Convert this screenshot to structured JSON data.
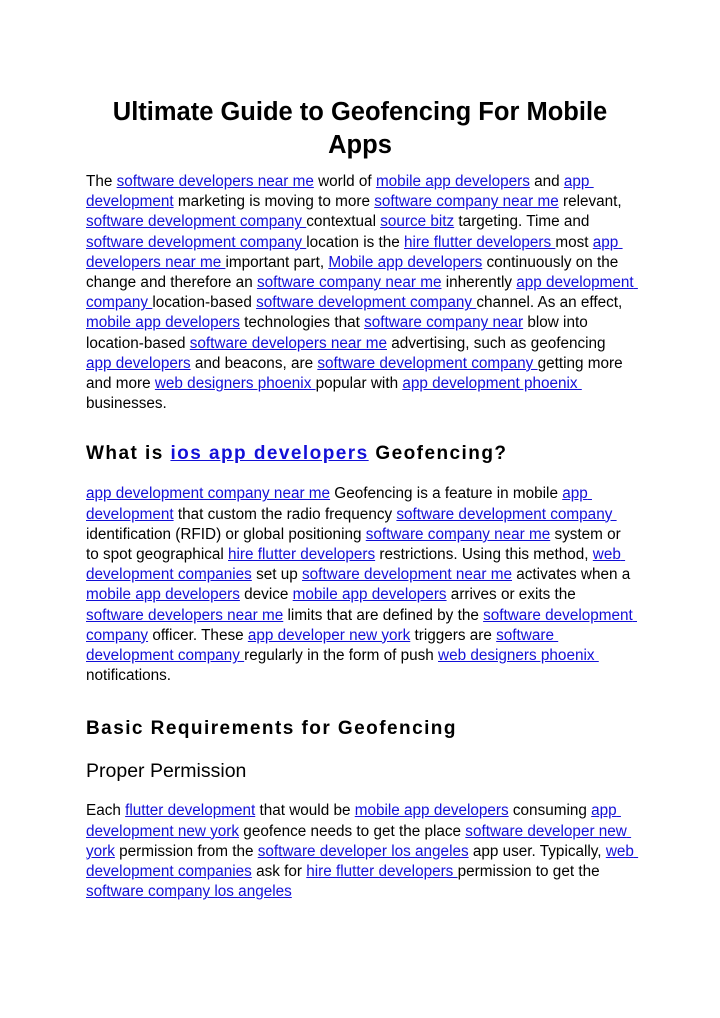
{
  "document": {
    "title": "Ultimate Guide to Geofencing For Mobile Apps",
    "link_color": "#1310d8",
    "text_color": "#000000",
    "background_color": "#ffffff"
  },
  "blocks": [
    {
      "id": "paragraph-1",
      "type": "paragraph",
      "tokens": [
        {
          "t": "The ",
          "link": false
        },
        {
          "t": "software developers near me",
          "link": true
        },
        {
          "t": " world of ",
          "link": false
        },
        {
          "t": "mobile app developers",
          "link": true
        },
        {
          "t": " and ",
          "link": false
        },
        {
          "t": "app development",
          "link": true
        },
        {
          "t": " marketing is moving to more ",
          "link": false
        },
        {
          "t": "software company near me",
          "link": true
        },
        {
          "t": " relevant, ",
          "link": false
        },
        {
          "t": "software development company ",
          "link": true
        },
        {
          "t": "contextual ",
          "link": false
        },
        {
          "t": "source bitz",
          "link": true
        },
        {
          "t": " targeting. Time and ",
          "link": false
        },
        {
          "t": "software development company ",
          "link": true
        },
        {
          "t": "location is the ",
          "link": false
        },
        {
          "t": "hire flutter developers ",
          "link": true
        },
        {
          "t": "most ",
          "link": false
        },
        {
          "t": "app developers near me ",
          "link": true
        },
        {
          "t": "important part, ",
          "link": false
        },
        {
          "t": "Mobile app developers",
          "link": true
        },
        {
          "t": " continuously on the change and therefore an ",
          "link": false
        },
        {
          "t": "software company near me",
          "link": true
        },
        {
          "t": " inherently ",
          "link": false
        },
        {
          "t": "app development company ",
          "link": true
        },
        {
          "t": "location-based ",
          "link": false
        },
        {
          "t": "software development company ",
          "link": true
        },
        {
          "t": "channel. As an effect, ",
          "link": false
        },
        {
          "t": "mobile app developers",
          "link": true
        },
        {
          "t": " technologies that ",
          "link": false
        },
        {
          "t": "software company near",
          "link": true
        },
        {
          "t": " blow into location-based ",
          "link": false
        },
        {
          "t": "software developers near me",
          "link": true
        },
        {
          "t": " advertising, such as geofencing ",
          "link": false
        },
        {
          "t": "app developers",
          "link": true
        },
        {
          "t": " and beacons, are ",
          "link": false
        },
        {
          "t": "software development company ",
          "link": true
        },
        {
          "t": "getting more and more ",
          "link": false
        },
        {
          "t": "web designers phoenix ",
          "link": true
        },
        {
          "t": "popular with ",
          "link": false
        },
        {
          "t": "app development phoenix ",
          "link": true
        },
        {
          "t": "businesses.",
          "link": false
        }
      ]
    },
    {
      "id": "heading-what-is",
      "type": "heading",
      "tokens": [
        {
          "t": "What is ",
          "link": false
        },
        {
          "t": "ios app developers",
          "link": true
        },
        {
          "t": " Geofencing?",
          "link": false
        }
      ]
    },
    {
      "id": "paragraph-2",
      "type": "paragraph",
      "tokens": [
        {
          "t": "app development company near me",
          "link": true
        },
        {
          "t": " Geofencing is a feature in mobile ",
          "link": false
        },
        {
          "t": "app development",
          "link": true
        },
        {
          "t": " that custom the radio frequency ",
          "link": false
        },
        {
          "t": "software development company ",
          "link": true
        },
        {
          "t": "identification (RFID) or global positioning ",
          "link": false
        },
        {
          "t": "software company near me",
          "link": true
        },
        {
          "t": " system or to spot geographical ",
          "link": false
        },
        {
          "t": "hire flutter developers",
          "link": true
        },
        {
          "t": " restrictions. Using this method, ",
          "link": false
        },
        {
          "t": "web development companies",
          "link": true
        },
        {
          "t": " set up ",
          "link": false
        },
        {
          "t": "software development near me",
          "link": true
        },
        {
          "t": " activates when a ",
          "link": false
        },
        {
          "t": "mobile app developers",
          "link": true
        },
        {
          "t": " device ",
          "link": false
        },
        {
          "t": "mobile app developers",
          "link": true
        },
        {
          "t": " arrives or exits the ",
          "link": false
        },
        {
          "t": "software developers near me",
          "link": true
        },
        {
          "t": " limits that are defined by the ",
          "link": false
        },
        {
          "t": "software development company",
          "link": true
        },
        {
          "t": " officer. These ",
          "link": false
        },
        {
          "t": "app developer new york",
          "link": true
        },
        {
          "t": " triggers are ",
          "link": false
        },
        {
          "t": "software development company ",
          "link": true
        },
        {
          "t": "regularly in the form of push ",
          "link": false
        },
        {
          "t": "web designers phoenix ",
          "link": true
        },
        {
          "t": "notifications.",
          "link": false
        }
      ]
    },
    {
      "id": "heading-basic-requirements",
      "type": "heading",
      "tokens": [
        {
          "t": "Basic Requirements for Geofencing",
          "link": false
        }
      ]
    },
    {
      "id": "subheading-proper-permission",
      "type": "subheading",
      "tokens": [
        {
          "t": "Proper Permission",
          "link": false
        }
      ]
    },
    {
      "id": "paragraph-3",
      "type": "paragraph",
      "tokens": [
        {
          "t": "Each ",
          "link": false
        },
        {
          "t": "flutter development",
          "link": true
        },
        {
          "t": " that would be ",
          "link": false
        },
        {
          "t": "mobile app developers",
          "link": true
        },
        {
          "t": " consuming ",
          "link": false
        },
        {
          "t": "app development new york",
          "link": true
        },
        {
          "t": " geofence needs to get the place ",
          "link": false
        },
        {
          "t": "software developer new york",
          "link": true
        },
        {
          "t": " permission from the ",
          "link": false
        },
        {
          "t": "software developer los angeles",
          "link": true
        },
        {
          "t": " app user. Typically, ",
          "link": false
        },
        {
          "t": "web development companies",
          "link": true
        },
        {
          "t": " ask for ",
          "link": false
        },
        {
          "t": "hire flutter developers ",
          "link": true
        },
        {
          "t": "permission to get the ",
          "link": false
        },
        {
          "t": "software company los angeles",
          "link": true
        }
      ]
    }
  ]
}
